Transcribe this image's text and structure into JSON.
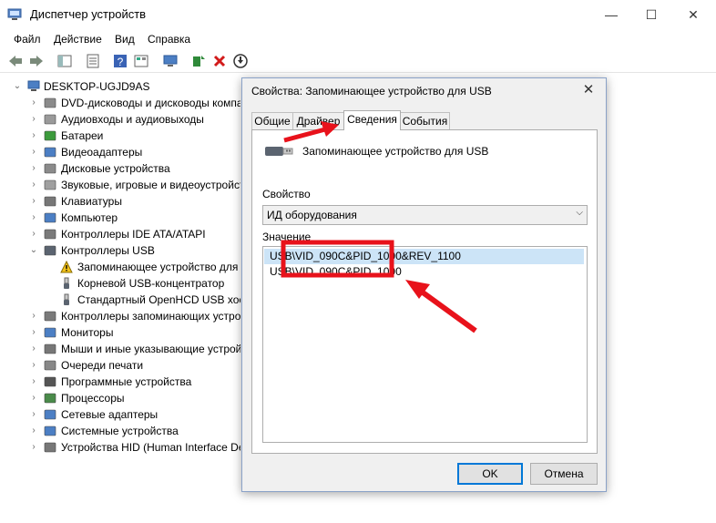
{
  "window": {
    "title": "Диспетчер устройств",
    "minimize": "—",
    "maximize": "☐",
    "close": "✕"
  },
  "menu": [
    "Файл",
    "Действие",
    "Вид",
    "Справка"
  ],
  "tree": {
    "root": "DESKTOP-UGJD9AS",
    "items": [
      {
        "label": "DVD-дисководы и дисководы компакт-дисков",
        "icon": "dvd-drive-icon"
      },
      {
        "label": "Аудиовходы и аудиовыходы",
        "icon": "speaker-icon"
      },
      {
        "label": "Батареи",
        "icon": "battery-icon"
      },
      {
        "label": "Видеоадаптеры",
        "icon": "display-adapter-icon"
      },
      {
        "label": "Дисковые устройства",
        "icon": "disk-drive-icon"
      },
      {
        "label": "Звуковые, игровые и видеоустройства",
        "icon": "sound-icon"
      },
      {
        "label": "Клавиатуры",
        "icon": "keyboard-icon"
      },
      {
        "label": "Компьютер",
        "icon": "computer-icon"
      },
      {
        "label": "Контроллеры IDE ATA/ATAPI",
        "icon": "ide-controller-icon"
      },
      {
        "label": "Контроллеры USB",
        "icon": "usb-controller-icon",
        "expanded": true
      },
      {
        "label": "Запоминающее устройство для USB",
        "icon": "warning-usb-icon",
        "child": true
      },
      {
        "label": "Корневой USB-концентратор",
        "icon": "usb-plug-icon",
        "child": true
      },
      {
        "label": "Стандартный OpenHCD USB хост-контроллер",
        "icon": "usb-plug-icon",
        "child": true
      },
      {
        "label": "Контроллеры запоминающих устройств",
        "icon": "storage-controller-icon"
      },
      {
        "label": "Мониторы",
        "icon": "monitor-icon"
      },
      {
        "label": "Мыши и иные указывающие устройства",
        "icon": "mouse-icon"
      },
      {
        "label": "Очереди печати",
        "icon": "printer-icon"
      },
      {
        "label": "Программные устройства",
        "icon": "software-device-icon"
      },
      {
        "label": "Процессоры",
        "icon": "cpu-icon"
      },
      {
        "label": "Сетевые адаптеры",
        "icon": "network-adapter-icon"
      },
      {
        "label": "Системные устройства",
        "icon": "system-device-icon"
      },
      {
        "label": "Устройства HID (Human Interface Devices)",
        "icon": "hid-icon"
      }
    ]
  },
  "dialog": {
    "title": "Свойства: Запоминающее устройство для USB",
    "close": "✕",
    "tabs": [
      "Общие",
      "Драйвер",
      "Сведения",
      "События"
    ],
    "active_tab": "Сведения",
    "device_name": "Запоминающее устройство для USB",
    "property_label": "Свойство",
    "property_value": "ИД оборудования",
    "value_label": "Значение",
    "values": [
      "USB\\VID_090C&PID_1000&REV_1100",
      "USB\\VID_090C&PID_1000"
    ],
    "ok": "OK",
    "cancel": "Отмена"
  },
  "colors": {
    "annotation_red": "#e8121b",
    "selection": "#cce4f7",
    "accent": "#0078d7"
  }
}
